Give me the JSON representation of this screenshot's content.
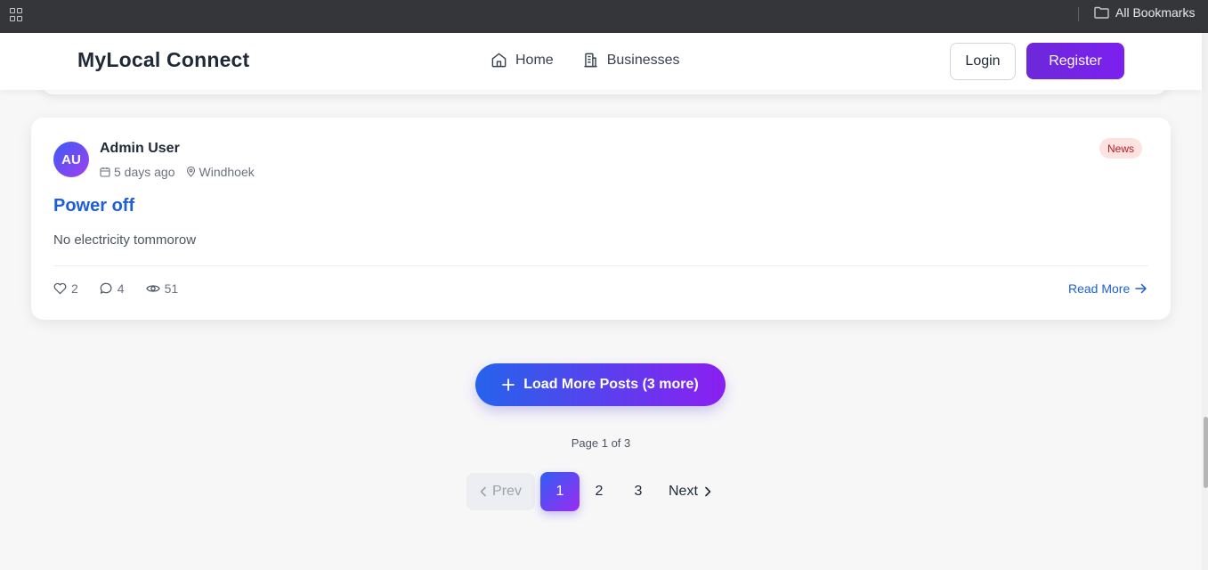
{
  "browser": {
    "bookmarks_label": "All Bookmarks"
  },
  "header": {
    "brand": "MyLocal Connect",
    "nav": [
      {
        "label": "Home",
        "icon": "home-icon"
      },
      {
        "label": "Businesses",
        "icon": "building-icon"
      }
    ],
    "login_label": "Login",
    "register_label": "Register"
  },
  "post": {
    "avatar_initials": "AU",
    "author": "Admin User",
    "time_ago": "5 days ago",
    "location": "Windhoek",
    "category": "News",
    "title": "Power off",
    "excerpt": "No electricity tommorow",
    "likes": "2",
    "comments": "4",
    "views": "51",
    "read_more_label": "Read More"
  },
  "load_more_label": "Load More Posts (3 more)",
  "pagination": {
    "info": "Page 1 of 3",
    "prev_label": "Prev",
    "pages": [
      "1",
      "2",
      "3"
    ],
    "current_page": "1",
    "next_label": "Next"
  },
  "colors": {
    "brand_gradient_start": "#2563eb",
    "brand_gradient_end": "#8b1ff0",
    "register_purple": "#6d28d9",
    "link_blue": "#1d5fd8",
    "badge_bg": "#fde2e2",
    "badge_text": "#b91c1c"
  }
}
